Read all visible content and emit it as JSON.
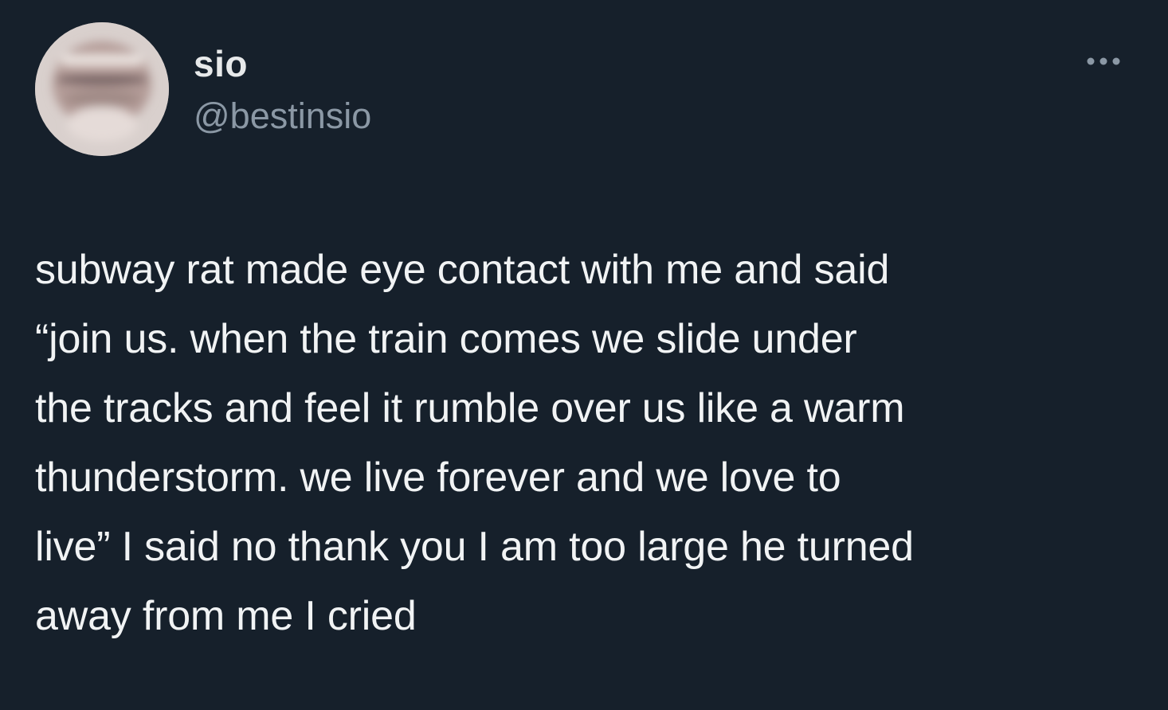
{
  "tweet": {
    "author": {
      "display_name": "sio",
      "handle": "@bestinsio"
    },
    "text": "subway rat made eye contact with me and said\n“join us. when the train comes we slide under\nthe tracks and feel it rumble over us like a warm\nthunderstorm. we live forever and we love to\nlive” I said no thank you I am too large he turned\naway from me I cried",
    "more_icon": "ellipsis-icon"
  },
  "colors": {
    "background": "#16202b",
    "text": "#f1f3f4",
    "secondary_text": "#8b98a5"
  }
}
